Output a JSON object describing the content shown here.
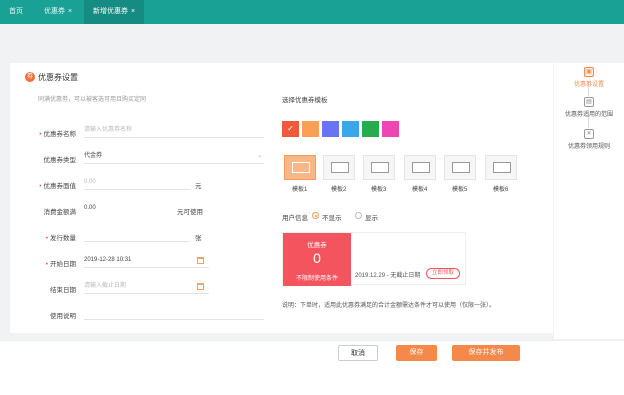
{
  "tabs": {
    "home": "首页",
    "coupons": "优惠券",
    "new_coupon": "新增优惠券",
    "close_glyph": "×"
  },
  "section": {
    "icon_glyph": "券",
    "title": "优惠券设置",
    "description": "同满优惠劵，可以被客选可用且购买定同"
  },
  "form": {
    "name": {
      "label": "优惠券名称",
      "placeholder": "请输入优惠券名称",
      "required": true
    },
    "type": {
      "label": "优惠券类型",
      "value": "代金券",
      "required": false
    },
    "face_value": {
      "label": "优惠券面值",
      "placeholder": "0.00",
      "unit": "元",
      "required": true
    },
    "threshold": {
      "label": "消费金额满",
      "value": "0.00",
      "unit": "元可使用",
      "required": false
    },
    "quantity": {
      "label": "发行数量",
      "unit": "张",
      "required": true
    },
    "start_date": {
      "label": "开始日期",
      "value": "2019-12-28 10:31",
      "required": true
    },
    "end_date": {
      "label": "结束日期",
      "placeholder": "请输入截止日期",
      "required": false
    },
    "instructions": {
      "label": "使用说明",
      "required": false
    }
  },
  "style": {
    "heading": "选择优惠券模板",
    "colors": [
      "#f05a3a",
      "#f9a053",
      "#6a73f2",
      "#38a8ec",
      "#26ab4f",
      "#f044b5"
    ],
    "templates": [
      "模板1",
      "模板2",
      "模板3",
      "模板4",
      "模板5",
      "模板6"
    ],
    "selected_template": 0
  },
  "user_info": {
    "label": "用户信息",
    "options": [
      "不显示",
      "显示"
    ],
    "selected": 0
  },
  "preview": {
    "name": "优惠券",
    "amount": "0",
    "limit": "不限制使用条件",
    "date": "2019.12.29 - 无截止日期",
    "button": "立即领取"
  },
  "note": "说明：下单时，适用此优惠券满足的合计金额需达条件才可以使用（仅限一张）。",
  "right_nav": [
    {
      "label": "优惠券设置",
      "icon": "coupon-icon",
      "glyph": "▣",
      "active": true
    },
    {
      "label": "优惠券适用的范围",
      "icon": "scope-icon",
      "glyph": "▤",
      "active": false
    },
    {
      "label": "优惠券领用规则",
      "icon": "rule-icon",
      "glyph": "✕",
      "active": false
    }
  ],
  "footer": {
    "cancel": "取消",
    "save": "保存",
    "save_publish": "保存并发布"
  }
}
